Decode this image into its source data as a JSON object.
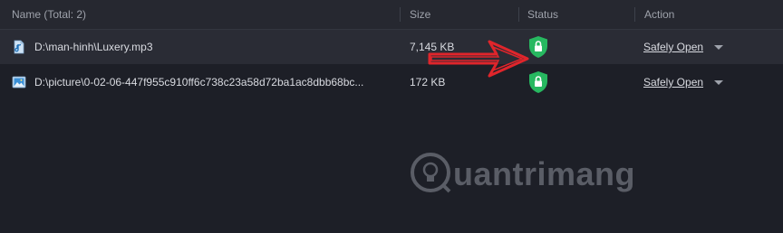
{
  "columns": {
    "name": "Name (Total: 2)",
    "size": "Size",
    "status": "Status",
    "action": "Action"
  },
  "rows": [
    {
      "icon": "audio-file-icon",
      "name": "D:\\man-hinh\\Luxery.mp3",
      "size": "7,145 KB",
      "status_icon": "shield-lock-icon",
      "action": "Safely Open"
    },
    {
      "icon": "image-file-icon",
      "name": "D:\\picture\\0-02-06-447f955c910ff6c738c23a58d72ba1ac8dbb68bc...",
      "size": "172 KB",
      "status_icon": "shield-lock-icon",
      "action": "Safely Open"
    }
  ],
  "watermark": "uantrimang",
  "colors": {
    "background": "#1d1f27",
    "header": "#262830",
    "selected_row": "#2a2c35",
    "shield": "#27b860",
    "arrow": "#e0252b"
  }
}
